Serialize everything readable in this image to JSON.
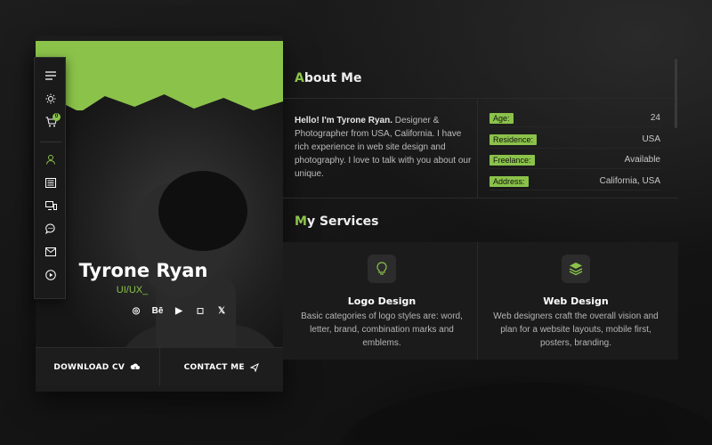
{
  "profile": {
    "name": "Tyrone Ryan",
    "role": "UI/UX_",
    "socials": [
      {
        "icon": "dribbble-icon",
        "glyph": "◎"
      },
      {
        "icon": "behance-icon",
        "glyph": "Bē"
      },
      {
        "icon": "youtube-icon",
        "glyph": "▶"
      },
      {
        "icon": "instagram-icon",
        "glyph": "◻"
      },
      {
        "icon": "x-icon",
        "glyph": "𝕏"
      }
    ],
    "download_label": "DOWNLOAD CV",
    "contact_label": "CONTACT ME"
  },
  "sidebar": {
    "items": [
      {
        "icon": "menu-icon"
      },
      {
        "icon": "theme-toggle-icon"
      },
      {
        "icon": "cart-icon",
        "badge": "0"
      },
      {
        "icon": "user-icon"
      },
      {
        "icon": "resume-icon"
      },
      {
        "icon": "portfolio-icon"
      },
      {
        "icon": "chat-icon"
      },
      {
        "icon": "mail-icon"
      },
      {
        "icon": "play-icon"
      }
    ]
  },
  "about": {
    "title_first": "A",
    "title_rest": "bout Me",
    "intro_bold": "Hello! I'm Tyrone Ryan.",
    "intro_text": " Designer & Photographer from USA, California. I have rich experience in web site design and photography. I love to talk with you about our unique.",
    "info": [
      {
        "label": "Age:",
        "value": "24"
      },
      {
        "label": "Residence:",
        "value": "USA"
      },
      {
        "label": "Freelance:",
        "value": "Available"
      },
      {
        "label": "Address:",
        "value": "California, USA"
      }
    ]
  },
  "services": {
    "title_first": "M",
    "title_rest": "y Services",
    "items": [
      {
        "icon": "lightbulb-icon",
        "title": "Logo Design",
        "desc": "Basic categories of logo styles are: word, letter, brand, combination marks and emblems."
      },
      {
        "icon": "layers-icon",
        "title": "Web Design",
        "desc": "Web designers craft the overall vision and plan for a website layouts, mobile first, posters, branding."
      }
    ]
  },
  "colors": {
    "accent": "#8bc34a",
    "background": "#151515"
  }
}
